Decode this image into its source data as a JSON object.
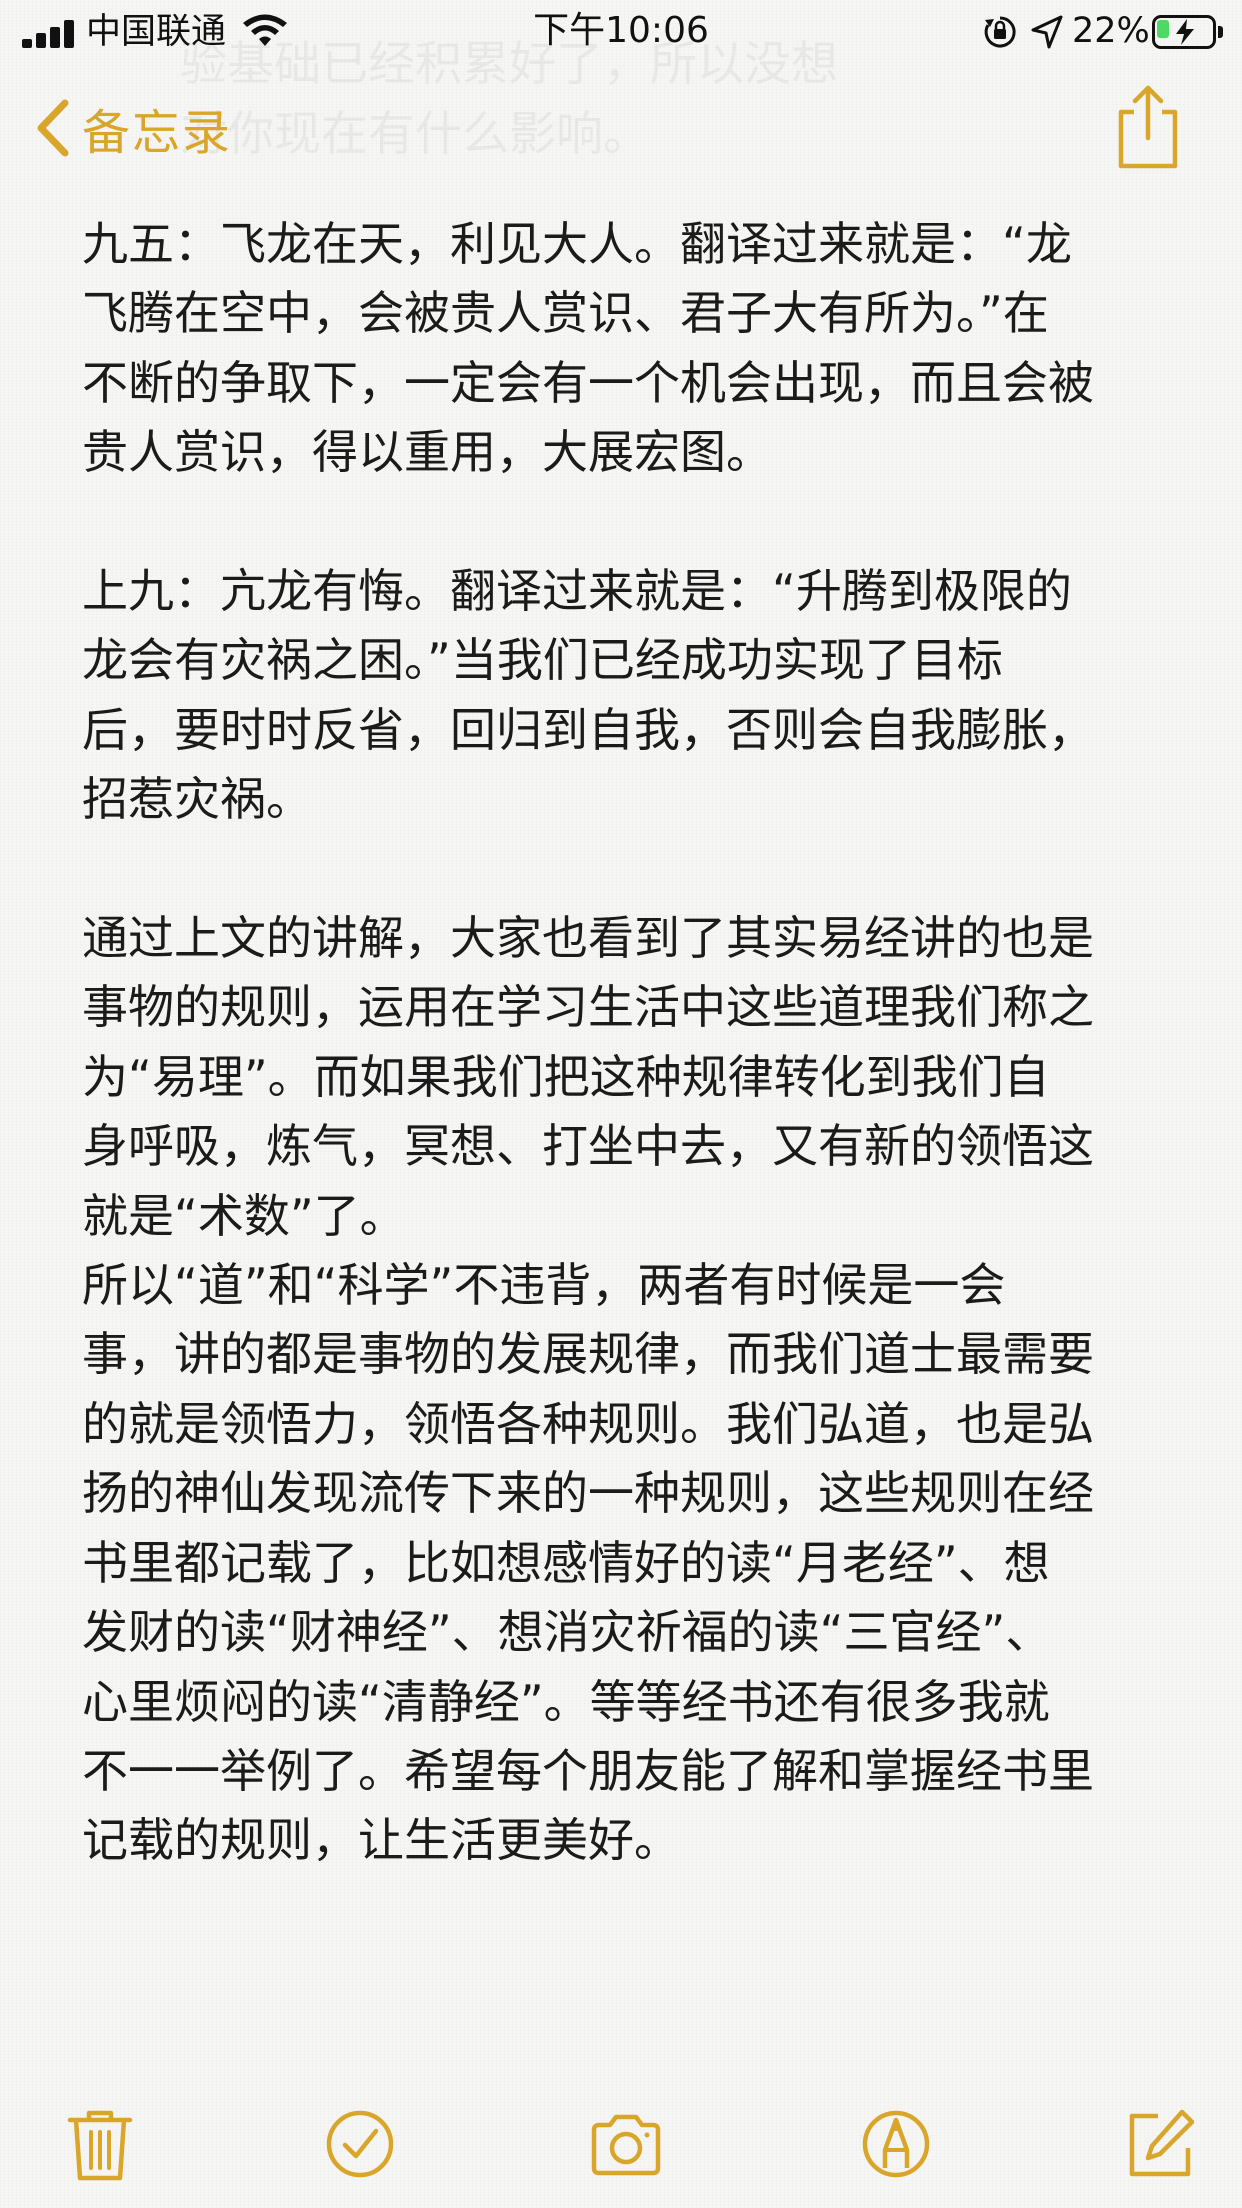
{
  "status_bar": {
    "carrier": "中国联通",
    "time": "下午10:06",
    "battery_percent": "22%",
    "battery_level": 0.22,
    "signal_bars_filled": 4
  },
  "ghost_text": [
    "验基础已经积累好了，所以没想",
    "对你现在有什么影响。"
  ],
  "nav": {
    "back_label": "备忘录",
    "back_icon": "chevron-left-icon",
    "share_icon": "share-icon",
    "accent_color": "#d9a52a"
  },
  "note": {
    "paragraphs": [
      {
        "lines": [
          "九五：飞龙在天，利见大人。翻译过来就是：“龙",
          "飞腾在空中，会被贵人赏识、君子大有所为。”在",
          "不断的争取下，一定会有一个机会出现，而且会被",
          "贵人赏识，得以重用，大展宏图。"
        ]
      },
      {
        "lines": [
          "上九：亢龙有悔。翻译过来就是：“升腾到极限的",
          "龙会有灾祸之困。”当我们已经成功实现了目标",
          "后，要时时反省，回归到自我，否则会自我膨胀，",
          "招惹灾祸。"
        ]
      },
      {
        "lines": [
          "通过上文的讲解，大家也看到了其实易经讲的也是",
          "事物的规则，运用在学习生活中这些道理我们称之",
          "为“易理”。而如果我们把这种规律转化到我们自",
          "身呼吸，炼气，冥想、打坐中去，又有新的领悟这",
          "就是“术数”了。",
          "所以“道”和“科学”不违背，两者有时候是一会",
          "事，讲的都是事物的发展规律，而我们道士最需要",
          "的就是领悟力，领悟各种规则。我们弘道，也是弘",
          "扬的神仙发现流传下来的一种规则，这些规则在经",
          "书里都记载了，比如想感情好的读“月老经”、想",
          "发财的读“财神经”、想消灾祈福的读“三官经”、",
          "心里烦闷的读“清静经”。等等经书还有很多我就",
          "不一一举例了。希望每个朋友能了解和掌握经书里",
          "记载的规则，让生活更美好。"
        ]
      }
    ]
  },
  "toolbar": {
    "items": [
      {
        "icon": "trash-icon"
      },
      {
        "icon": "checklist-icon"
      },
      {
        "icon": "camera-icon"
      },
      {
        "icon": "markup-pen-icon"
      },
      {
        "icon": "compose-icon"
      }
    ]
  }
}
